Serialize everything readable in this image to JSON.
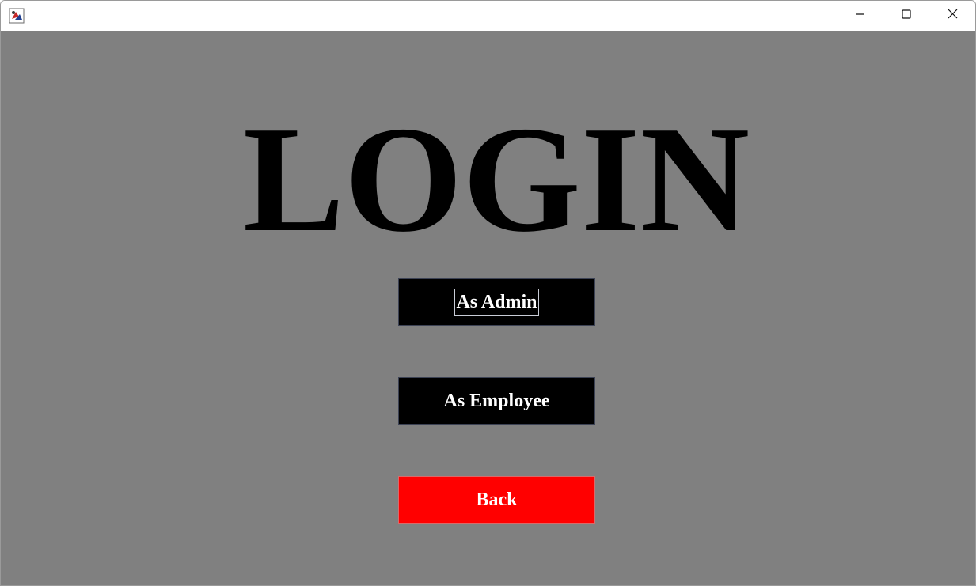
{
  "window": {
    "title": "",
    "icon": "java-app-icon",
    "controls": {
      "minimize_icon": "minimize-icon",
      "maximize_icon": "maximize-icon",
      "close_icon": "close-icon"
    }
  },
  "main": {
    "heading": "LOGIN",
    "buttons": {
      "admin_label": "As Admin",
      "employee_label": "As Employee",
      "back_label": "Back"
    }
  },
  "colors": {
    "background": "#808080",
    "primary_button": "#000000",
    "back_button": "#ff0000",
    "button_text": "#ffffff",
    "heading_text": "#000000"
  }
}
